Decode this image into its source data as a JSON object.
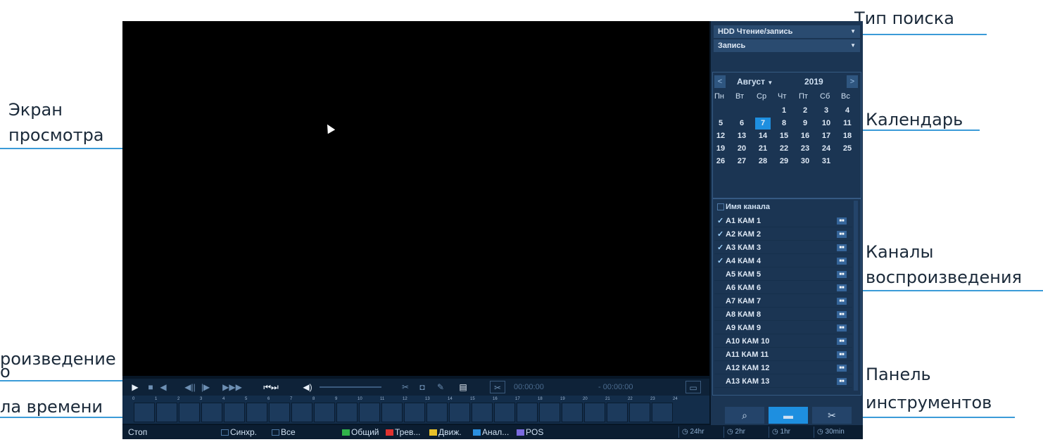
{
  "callouts": {
    "search_type": "Тип поиска",
    "view_screen_1": "Экран",
    "view_screen_2": "просмотра",
    "calendar": "Календарь",
    "channels_1": "Каналы",
    "channels_2": "воспроизведения",
    "playback_1": "роизведение",
    "playback_2": "о",
    "timeline": "ла времени",
    "toolbar_1": "Панель",
    "toolbar_2": "инструментов"
  },
  "search": {
    "source": "HDD Чтение/запись",
    "type": "Запись"
  },
  "calendar": {
    "month": "Август",
    "year": "2019",
    "prev": "<",
    "next": ">",
    "weekdays": [
      "Пн",
      "Вт",
      "Ср",
      "Чт",
      "Пт",
      "Сб",
      "Вс"
    ],
    "weeks": [
      [
        "",
        "",
        "",
        "1",
        "2",
        "3",
        "4"
      ],
      [
        "5",
        "6",
        "7",
        "8",
        "9",
        "10",
        "11"
      ],
      [
        "12",
        "13",
        "14",
        "15",
        "16",
        "17",
        "18"
      ],
      [
        "19",
        "20",
        "21",
        "22",
        "23",
        "24",
        "25"
      ],
      [
        "26",
        "27",
        "28",
        "29",
        "30",
        "31",
        ""
      ]
    ],
    "selected_day": "7"
  },
  "channels": {
    "header": "Имя канала",
    "items": [
      {
        "label": "A1 КАМ 1",
        "checked": true
      },
      {
        "label": "A2 КАМ 2",
        "checked": true
      },
      {
        "label": "A3 КАМ 3",
        "checked": true
      },
      {
        "label": "A4 КАМ 4",
        "checked": true
      },
      {
        "label": "A5 КАМ 5",
        "checked": false
      },
      {
        "label": "A6 КАМ 6",
        "checked": false
      },
      {
        "label": "A7 КАМ 7",
        "checked": false
      },
      {
        "label": "A8 КАМ 8",
        "checked": false
      },
      {
        "label": "A9 КАМ 9",
        "checked": false
      },
      {
        "label": "A10 КАМ 10",
        "checked": false
      },
      {
        "label": "A11 КАМ 11",
        "checked": false
      },
      {
        "label": "A12 КАМ 12",
        "checked": false
      },
      {
        "label": "A13 КАМ 13",
        "checked": false
      }
    ]
  },
  "controls": {
    "time_start": "00:00:00",
    "time_end": "- 00:00:00"
  },
  "timeline": {
    "ticks": [
      "0",
      "1",
      "2",
      "3",
      "4",
      "5",
      "6",
      "7",
      "8",
      "9",
      "10",
      "11",
      "12",
      "13",
      "14",
      "15",
      "16",
      "17",
      "18",
      "19",
      "20",
      "21",
      "22",
      "23",
      "24"
    ]
  },
  "status": {
    "state": "Стоп",
    "sync": "Синхр.",
    "all": "Все",
    "legend": [
      {
        "label": "Общий",
        "color": "#2fb34a"
      },
      {
        "label": "Трев...",
        "color": "#e0322f"
      },
      {
        "label": "Движ.",
        "color": "#e8c12a"
      },
      {
        "label": "Анал...",
        "color": "#2a8fe0"
      },
      {
        "label": "POS",
        "color": "#7a6ae0"
      }
    ],
    "zoom": [
      "24hr",
      "2hr",
      "1hr",
      "30min"
    ]
  }
}
